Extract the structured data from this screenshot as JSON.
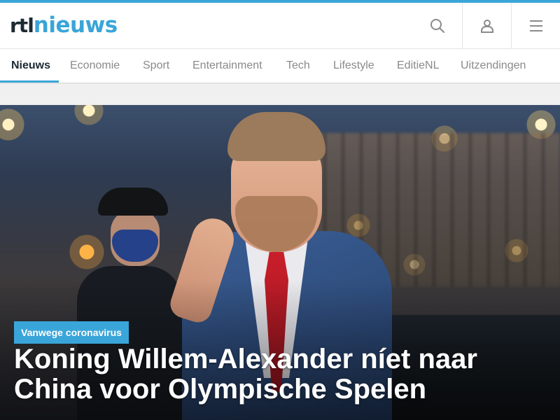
{
  "brand": {
    "logo_part1": "rtl",
    "logo_part2": "nieuws",
    "accent_color": "#3aa5d8",
    "dark_color": "#1c2a33"
  },
  "header": {
    "buttons": [
      {
        "icon": "search-icon"
      },
      {
        "icon": "user-icon"
      },
      {
        "icon": "hamburger-menu-icon"
      }
    ]
  },
  "nav": {
    "items": [
      {
        "label": "Nieuws",
        "active": true
      },
      {
        "label": "Economie",
        "active": false
      },
      {
        "label": "Sport",
        "active": false
      },
      {
        "label": "Entertainment",
        "active": false
      },
      {
        "label": "Tech",
        "active": false
      },
      {
        "label": "Lifestyle",
        "active": false
      },
      {
        "label": "EditieNL",
        "active": false
      },
      {
        "label": "Uitzendingen",
        "active": false
      }
    ]
  },
  "hero": {
    "tag": "Vanwege coronavirus",
    "title": "Koning Willem-Alexander níet naar China voor Olympische Spelen"
  }
}
